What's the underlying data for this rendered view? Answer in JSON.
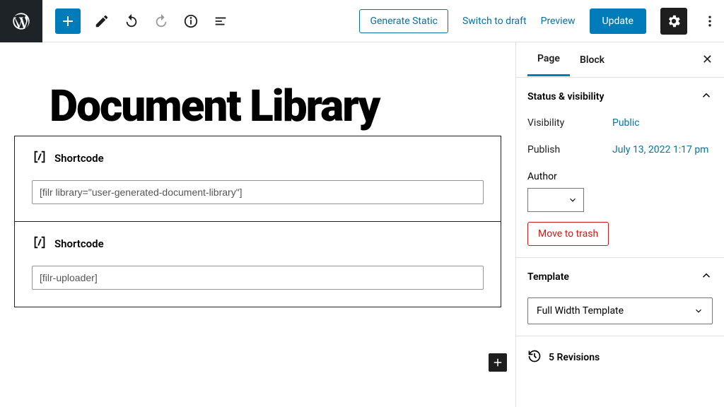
{
  "topbar": {
    "generate_static": "Generate Static",
    "switch_draft": "Switch to draft",
    "preview": "Preview",
    "update": "Update"
  },
  "page": {
    "title": "Document Library"
  },
  "blocks": {
    "shortcode_label": "Shortcode",
    "shortcode1_value": "[filr library=\"user-generated-document-library\"]",
    "shortcode2_value": "[filr-uploader]"
  },
  "sidebar": {
    "tabs": {
      "page": "Page",
      "block": "Block"
    },
    "status_visibility": {
      "title": "Status & visibility",
      "visibility_label": "Visibility",
      "visibility_value": "Public",
      "publish_label": "Publish",
      "publish_value": "July 13, 2022 1:17 pm",
      "author_label": "Author",
      "trash": "Move to trash"
    },
    "template": {
      "title": "Template",
      "value": "Full Width Template"
    },
    "revisions": "5 Revisions"
  }
}
